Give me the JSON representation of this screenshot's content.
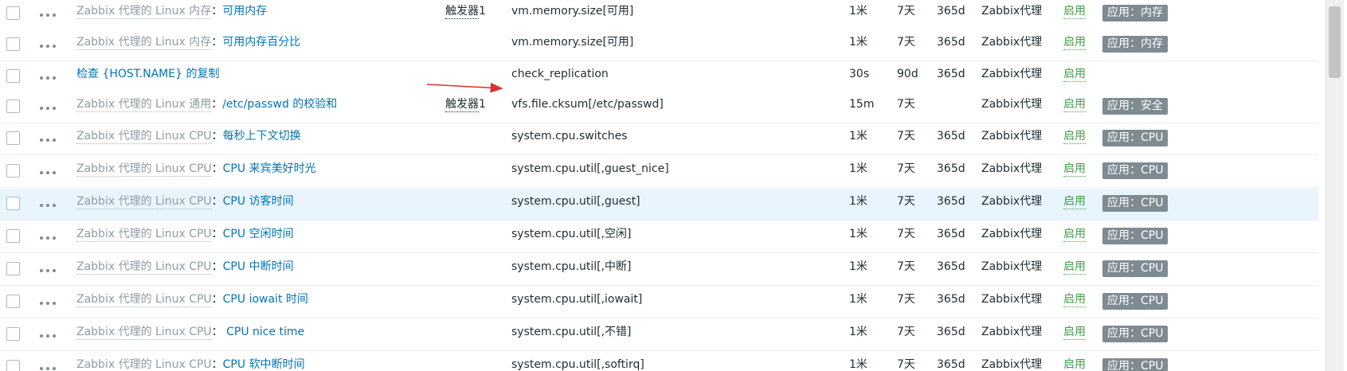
{
  "colors": {
    "link": "#0275b8",
    "template": "#8e9ca4",
    "status_enabled": "#429e47",
    "tag_bg": "#7f8b92",
    "row_highlight": "#e8f5ff",
    "annotation_arrow": "#e03030"
  },
  "items": [
    {
      "template": "Zabbix 代理的 Linux 内存",
      "name": "可用内存",
      "triggers_label": "触发器",
      "triggers_count": "1",
      "key": "vm.memory.size[可用]",
      "interval": "1米",
      "history": "7天",
      "trends": "365d",
      "type": "Zabbix代理",
      "status": "启用",
      "tag": "应用：内存"
    },
    {
      "template": "Zabbix 代理的 Linux 内存",
      "name": "可用内存百分比",
      "triggers_label": "",
      "triggers_count": "",
      "key": "vm.memory.size[可用]",
      "interval": "1米",
      "history": "7天",
      "trends": "365d",
      "type": "Zabbix代理",
      "status": "启用",
      "tag": "应用：内存"
    },
    {
      "template": "",
      "name": "检查 {HOST.NAME} 的复制",
      "triggers_label": "",
      "triggers_count": "",
      "key": "check_replication",
      "interval": "30s",
      "history": "90d",
      "trends": "365d",
      "type": "Zabbix代理",
      "status": "启用",
      "tag": ""
    },
    {
      "template": "Zabbix 代理的 Linux 通用",
      "name": "/etc/passwd 的校验和",
      "triggers_label": "触发器",
      "triggers_count": "1",
      "key": "vfs.file.cksum[/etc/passwd]",
      "interval": "15m",
      "history": "7天",
      "trends": "",
      "type": "Zabbix代理",
      "status": "启用",
      "tag": "应用：安全"
    },
    {
      "template": "Zabbix 代理的 Linux CPU",
      "name": "每秒上下文切换",
      "triggers_label": "",
      "triggers_count": "",
      "key": "system.cpu.switches",
      "interval": "1米",
      "history": "7天",
      "trends": "365d",
      "type": "Zabbix代理",
      "status": "启用",
      "tag": "应用：CPU"
    },
    {
      "template": "Zabbix 代理的 Linux CPU",
      "name": "CPU 来宾美好时光",
      "triggers_label": "",
      "triggers_count": "",
      "key": "system.cpu.util[,guest_nice]",
      "interval": "1米",
      "history": "7天",
      "trends": "365d",
      "type": "Zabbix代理",
      "status": "启用",
      "tag": "应用：CPU"
    },
    {
      "template": "Zabbix 代理的 Linux CPU",
      "name": "CPU 访客时间",
      "triggers_label": "",
      "triggers_count": "",
      "key": "system.cpu.util[,guest]",
      "interval": "1米",
      "history": "7天",
      "trends": "365d",
      "type": "Zabbix代理",
      "status": "启用",
      "tag": "应用：CPU"
    },
    {
      "template": "Zabbix 代理的 Linux CPU",
      "name": "CPU 空闲时间",
      "triggers_label": "",
      "triggers_count": "",
      "key": "system.cpu.util[,空闲]",
      "interval": "1米",
      "history": "7天",
      "trends": "365d",
      "type": "Zabbix代理",
      "status": "启用",
      "tag": "应用：CPU"
    },
    {
      "template": "Zabbix 代理的 Linux CPU",
      "name": "CPU 中断时间",
      "triggers_label": "",
      "triggers_count": "",
      "key": "system.cpu.util[,中断]",
      "interval": "1米",
      "history": "7天",
      "trends": "365d",
      "type": "Zabbix代理",
      "status": "启用",
      "tag": "应用：CPU"
    },
    {
      "template": "Zabbix 代理的 Linux CPU",
      "name": "CPU iowait 时间",
      "triggers_label": "",
      "triggers_count": "",
      "key": "system.cpu.util[,iowait]",
      "interval": "1米",
      "history": "7天",
      "trends": "365d",
      "type": "Zabbix代理",
      "status": "启用",
      "tag": "应用：CPU"
    },
    {
      "template": "Zabbix 代理的 Linux CPU ",
      "name": " CPU nice time",
      "triggers_label": "",
      "triggers_count": "",
      "key": "system.cpu.util[,不错]",
      "interval": "1米",
      "history": "7天",
      "trends": "365d",
      "type": "Zabbix代理",
      "status": "启用",
      "tag": "应用：CPU"
    },
    {
      "template": "Zabbix 代理的 Linux CPU",
      "name": "CPU 软中断时间",
      "triggers_label": "",
      "triggers_count": "",
      "key": "system.cpu.util[,softirq]",
      "interval": "1米",
      "history": "7天",
      "trends": "365d",
      "type": "Zabbix代理",
      "status": "启用",
      "tag": "应用：CPU"
    }
  ],
  "highlighted_row": 6
}
